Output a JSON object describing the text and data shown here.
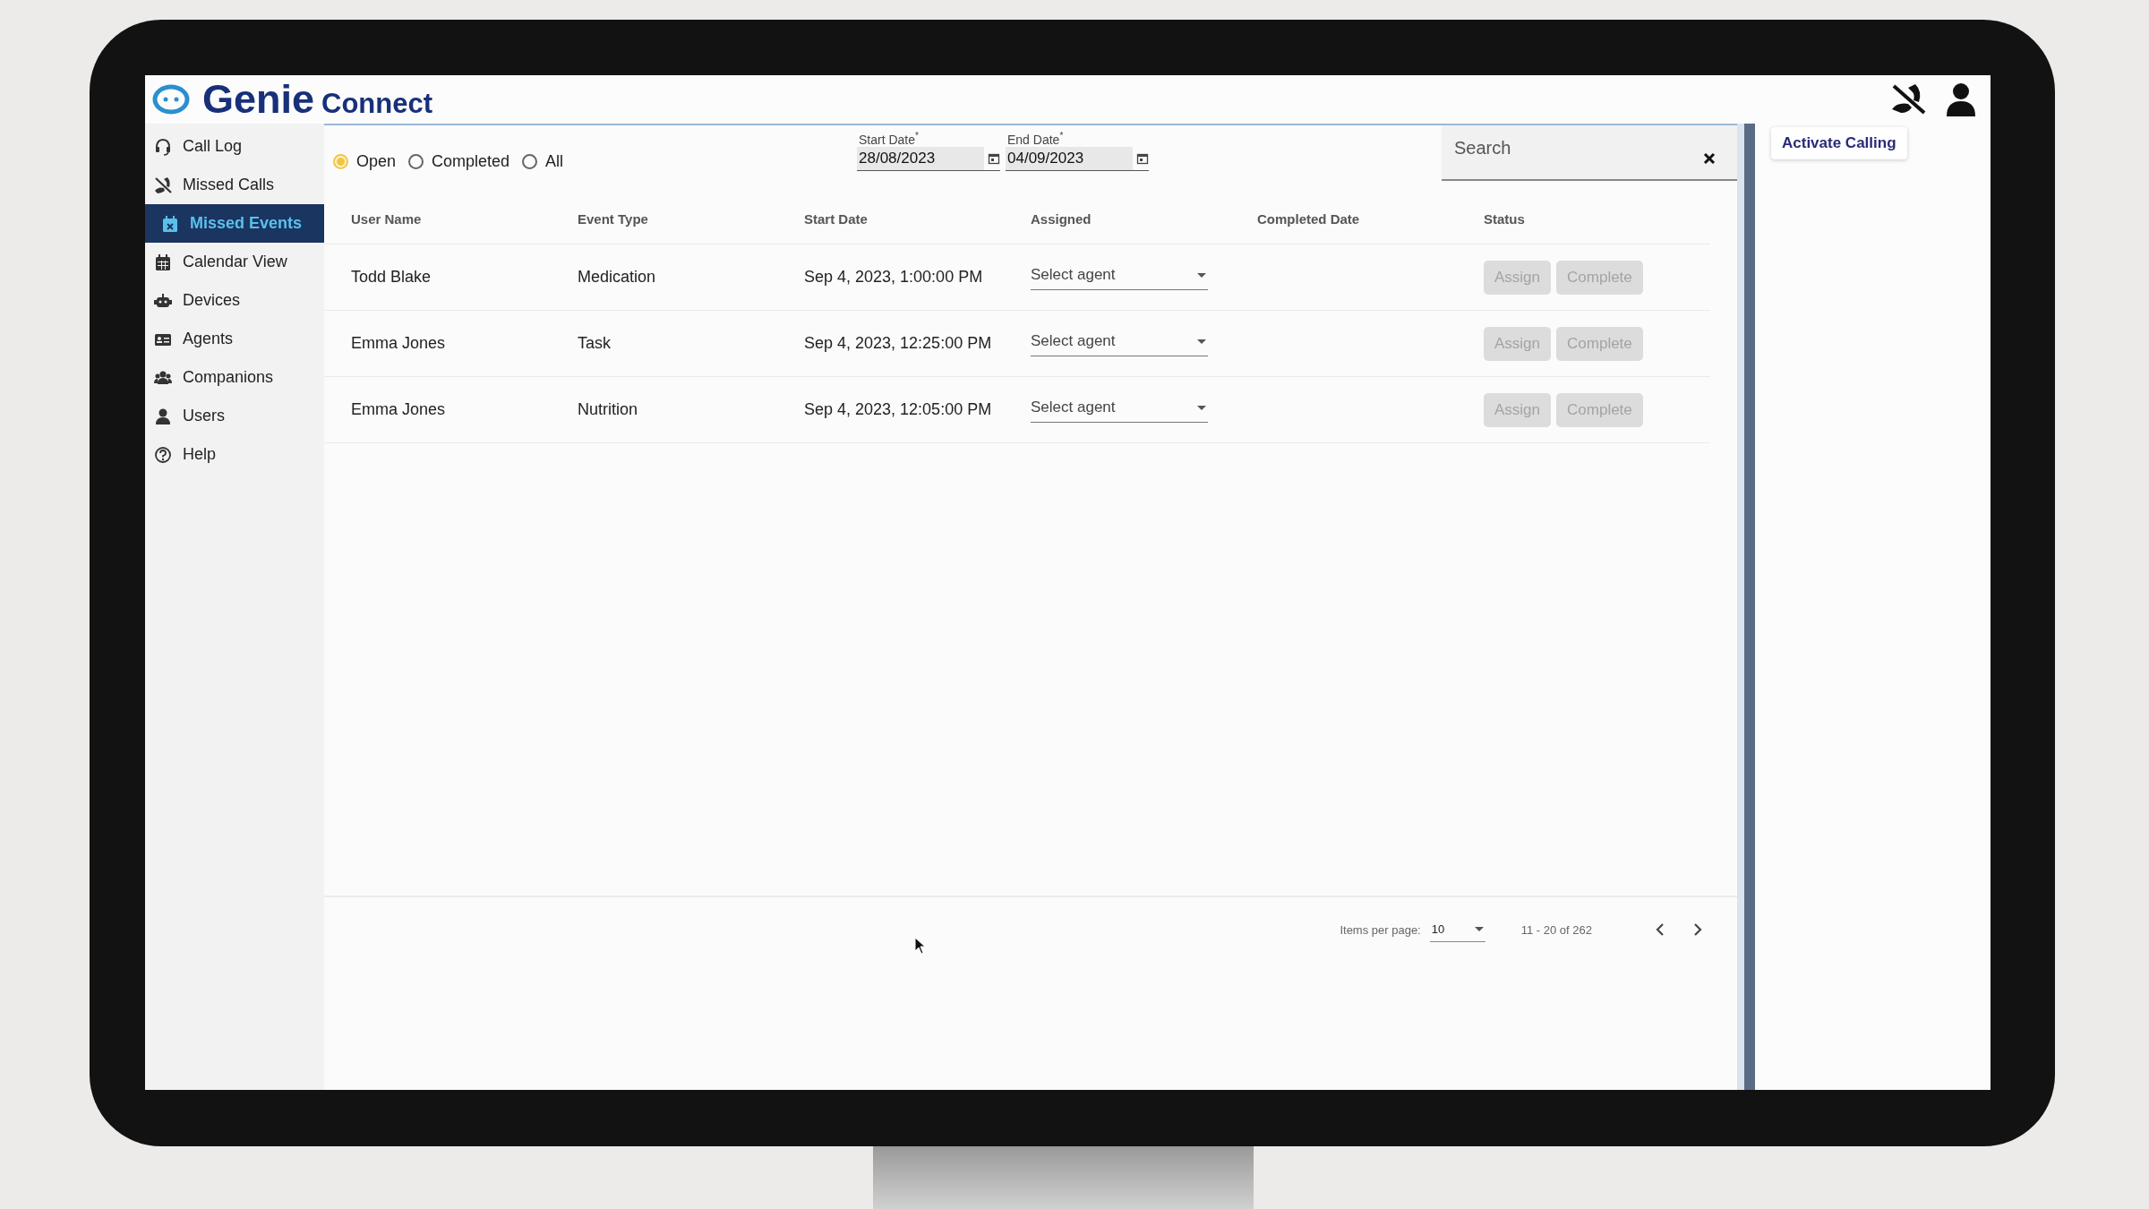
{
  "header": {
    "logo_primary": "Genie",
    "logo_secondary": "Connect"
  },
  "sidebar": {
    "items": [
      {
        "label": "Call Log",
        "kind": "headset",
        "selected": false
      },
      {
        "label": "Missed Calls",
        "kind": "missed-call",
        "selected": false
      },
      {
        "label": "Missed Events",
        "kind": "event",
        "selected": true
      },
      {
        "label": "Calendar View",
        "kind": "calendar",
        "selected": false
      },
      {
        "label": "Devices",
        "kind": "robot",
        "selected": false
      },
      {
        "label": "Agents",
        "kind": "card",
        "selected": false
      },
      {
        "label": "Companions",
        "kind": "group",
        "selected": false
      },
      {
        "label": "Users",
        "kind": "user",
        "selected": false
      },
      {
        "label": "Help",
        "kind": "help",
        "selected": false
      }
    ]
  },
  "filters": {
    "radios": [
      {
        "label": "Open",
        "selected": true
      },
      {
        "label": "Completed",
        "selected": false
      },
      {
        "label": "All",
        "selected": false
      }
    ],
    "dates": [
      {
        "label": "Start Date",
        "required_mark": "*",
        "value": "28/08/2023"
      },
      {
        "label": "End Date",
        "required_mark": "*",
        "value": "04/09/2023"
      }
    ],
    "search": {
      "placeholder": "Search"
    }
  },
  "table": {
    "columns": [
      "User Name",
      "Event Type",
      "Start Date",
      "Assigned",
      "Completed Date",
      "Status"
    ],
    "rows": [
      {
        "user_name": "Todd Blake",
        "event_type": "Medication",
        "start_date": "Sep 4, 2023, 1:00:00 PM",
        "assigned": {
          "placeholder": "Select agent"
        },
        "actions": [
          {
            "label": "Assign",
            "disabled": true
          },
          {
            "label": "Complete",
            "disabled": true
          }
        ]
      },
      {
        "user_name": "Emma Jones",
        "event_type": "Task",
        "start_date": "Sep 4, 2023, 12:25:00 PM",
        "assigned": {
          "placeholder": "Select agent"
        },
        "actions": [
          {
            "label": "Assign",
            "disabled": true
          },
          {
            "label": "Complete",
            "disabled": true
          }
        ]
      },
      {
        "user_name": "Emma Jones",
        "event_type": "Nutrition",
        "start_date": "Sep 4, 2023, 12:05:00 PM",
        "assigned": {
          "placeholder": "Select agent"
        },
        "actions": [
          {
            "label": "Assign",
            "disabled": true
          },
          {
            "label": "Complete",
            "disabled": true
          }
        ]
      }
    ]
  },
  "pagination": {
    "items_per_page_label": "Items per page:",
    "page_size": "10",
    "range": "11 - 20 of 262"
  },
  "side_panel": {
    "button": "Activate Calling"
  }
}
